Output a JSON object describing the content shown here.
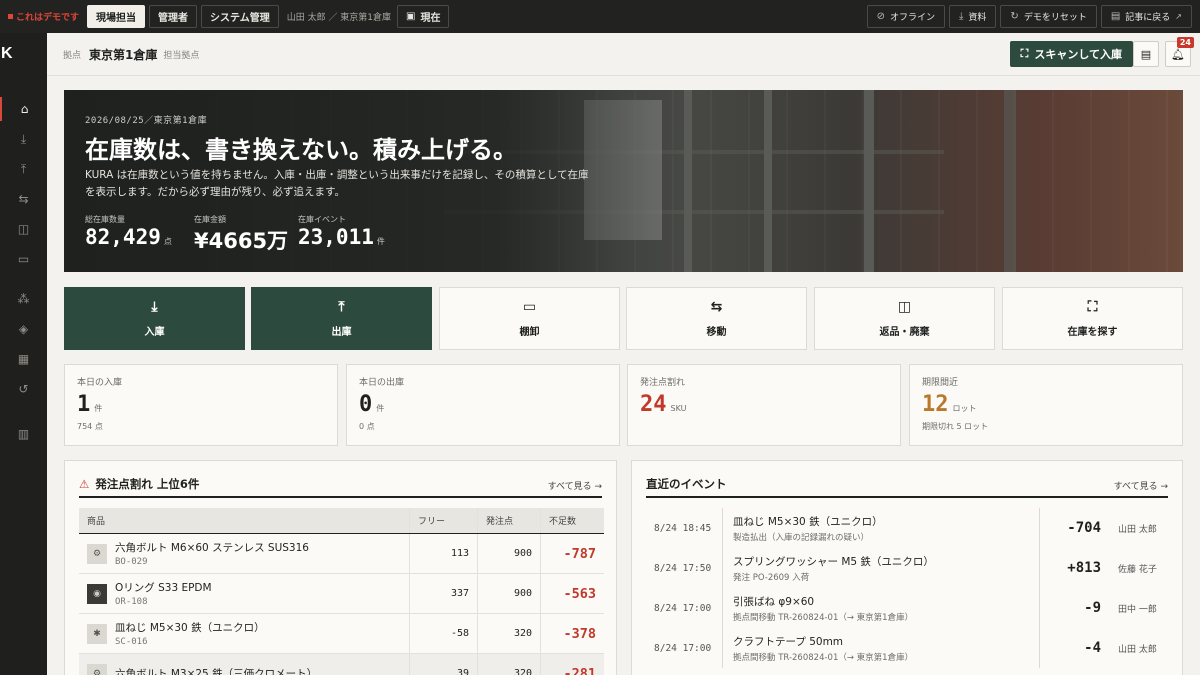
{
  "topbar": {
    "demo_label": "これはデモです",
    "roles": [
      {
        "label": "現場担当",
        "active": true
      },
      {
        "label": "管理者",
        "active": false
      },
      {
        "label": "システム管理",
        "active": false
      }
    ],
    "crumb": "山田 太郎 ／ 東京第1倉庫",
    "now_label": "現在",
    "right_buttons": [
      {
        "label": "オフライン",
        "icon": "wifi-off-icon"
      },
      {
        "label": "資料",
        "icon": "download-icon"
      },
      {
        "label": "デモをリセット",
        "icon": "reset-icon"
      },
      {
        "label": "記事に戻る",
        "icon": "external-link-icon"
      }
    ]
  },
  "sidebar": {
    "logo": "K",
    "icons": [
      "warehouse-icon",
      "inbound-icon",
      "outbound-icon",
      "transfer-icon",
      "trash-icon",
      "clipboard-icon",
      "network-icon",
      "layers-icon",
      "grid-icon",
      "history-icon",
      "layout-icon"
    ]
  },
  "header": {
    "kyoten_label": "拠点",
    "warehouse": "東京第1倉庫",
    "sub": "担当拠点",
    "scan_label": "スキャンして入庫",
    "notif_count": "24"
  },
  "hero": {
    "date": "2026/08/25／東京第1倉庫",
    "title": "在庫数は、書き換えない。積み上げる。",
    "desc": "KURA は在庫数という値を持ちません。入庫・出庫・調整という出来事だけを記録し、その積算として在庫を表示します。だから必ず理由が残り、必ず追えます。",
    "stats": [
      {
        "label": "総在庫数量",
        "value": "82,429",
        "unit": "点"
      },
      {
        "label": "在庫金額",
        "value": "¥4665万",
        "unit": ""
      },
      {
        "label": "在庫イベント",
        "value": "23,011",
        "unit": "件"
      }
    ]
  },
  "actions": [
    {
      "label": "入庫",
      "icon": "download-icon",
      "dark": true
    },
    {
      "label": "出庫",
      "icon": "upload-icon",
      "dark": true
    },
    {
      "label": "棚卸",
      "icon": "clipboard-icon",
      "dark": false
    },
    {
      "label": "移動",
      "icon": "transfer-icon",
      "dark": false
    },
    {
      "label": "返品・廃棄",
      "icon": "trash-icon",
      "dark": false
    },
    {
      "label": "在庫を探す",
      "icon": "scan-icon",
      "dark": false
    }
  ],
  "kpis": [
    {
      "label": "本日の入庫",
      "value": "1",
      "unit": "件",
      "sub": "754 点",
      "color": "#1f211f"
    },
    {
      "label": "本日の出庫",
      "value": "0",
      "unit": "件",
      "sub": "0 点",
      "color": "#1f211f"
    },
    {
      "label": "発注点割れ",
      "value": "24",
      "unit": "SKU",
      "sub": "",
      "color": "#c0392b"
    },
    {
      "label": "期限間近",
      "value": "12",
      "unit": "ロット",
      "sub": "期限切れ 5 ロット",
      "color": "#b8792b"
    }
  ],
  "reorder": {
    "title": "発注点割れ 上位6件",
    "link": "すべて見る →",
    "columns": [
      "商品",
      "フリー",
      "発注点",
      "不足数"
    ],
    "rows": [
      {
        "name": "六角ボルト M6×60 ステンレス SUS316",
        "code": "BO-029",
        "free": "113",
        "reorder": "900",
        "short": "-787"
      },
      {
        "name": "Oリング S33 EPDM",
        "code": "OR-108",
        "free": "337",
        "reorder": "900",
        "short": "-563"
      },
      {
        "name": "皿ねじ M5×30 鉄（ユニクロ）",
        "code": "SC-016",
        "free": "-58",
        "reorder": "320",
        "short": "-378"
      },
      {
        "name": "六角ボルト M3×25 鉄（三価クロメート）",
        "code": "",
        "free": "39",
        "reorder": "320",
        "short": "-281"
      }
    ]
  },
  "events": {
    "title": "直近のイベント",
    "link": "すべて見る →",
    "rows": [
      {
        "time": "8/24 18:45",
        "title": "皿ねじ M5×30 鉄（ユニクロ）",
        "sub": "製造払出（入庫の記録漏れの疑い）",
        "qty": "-704",
        "user": "山田 太郎"
      },
      {
        "time": "8/24 17:50",
        "title": "スプリングワッシャー M5 鉄（ユニクロ）",
        "sub": "発注 PO-2609 入荷",
        "qty": "+813",
        "user": "佐藤 花子"
      },
      {
        "time": "8/24 17:00",
        "title": "引張ばね φ9×60",
        "sub": "拠点間移動 TR-260824-01（→ 東京第1倉庫）",
        "qty": "-9",
        "user": "田中 一郎"
      },
      {
        "time": "8/24 17:00",
        "title": "クラフトテープ 50mm",
        "sub": "拠点間移動 TR-260824-01（→ 東京第1倉庫）",
        "qty": "-4",
        "user": "山田 太郎"
      }
    ]
  }
}
